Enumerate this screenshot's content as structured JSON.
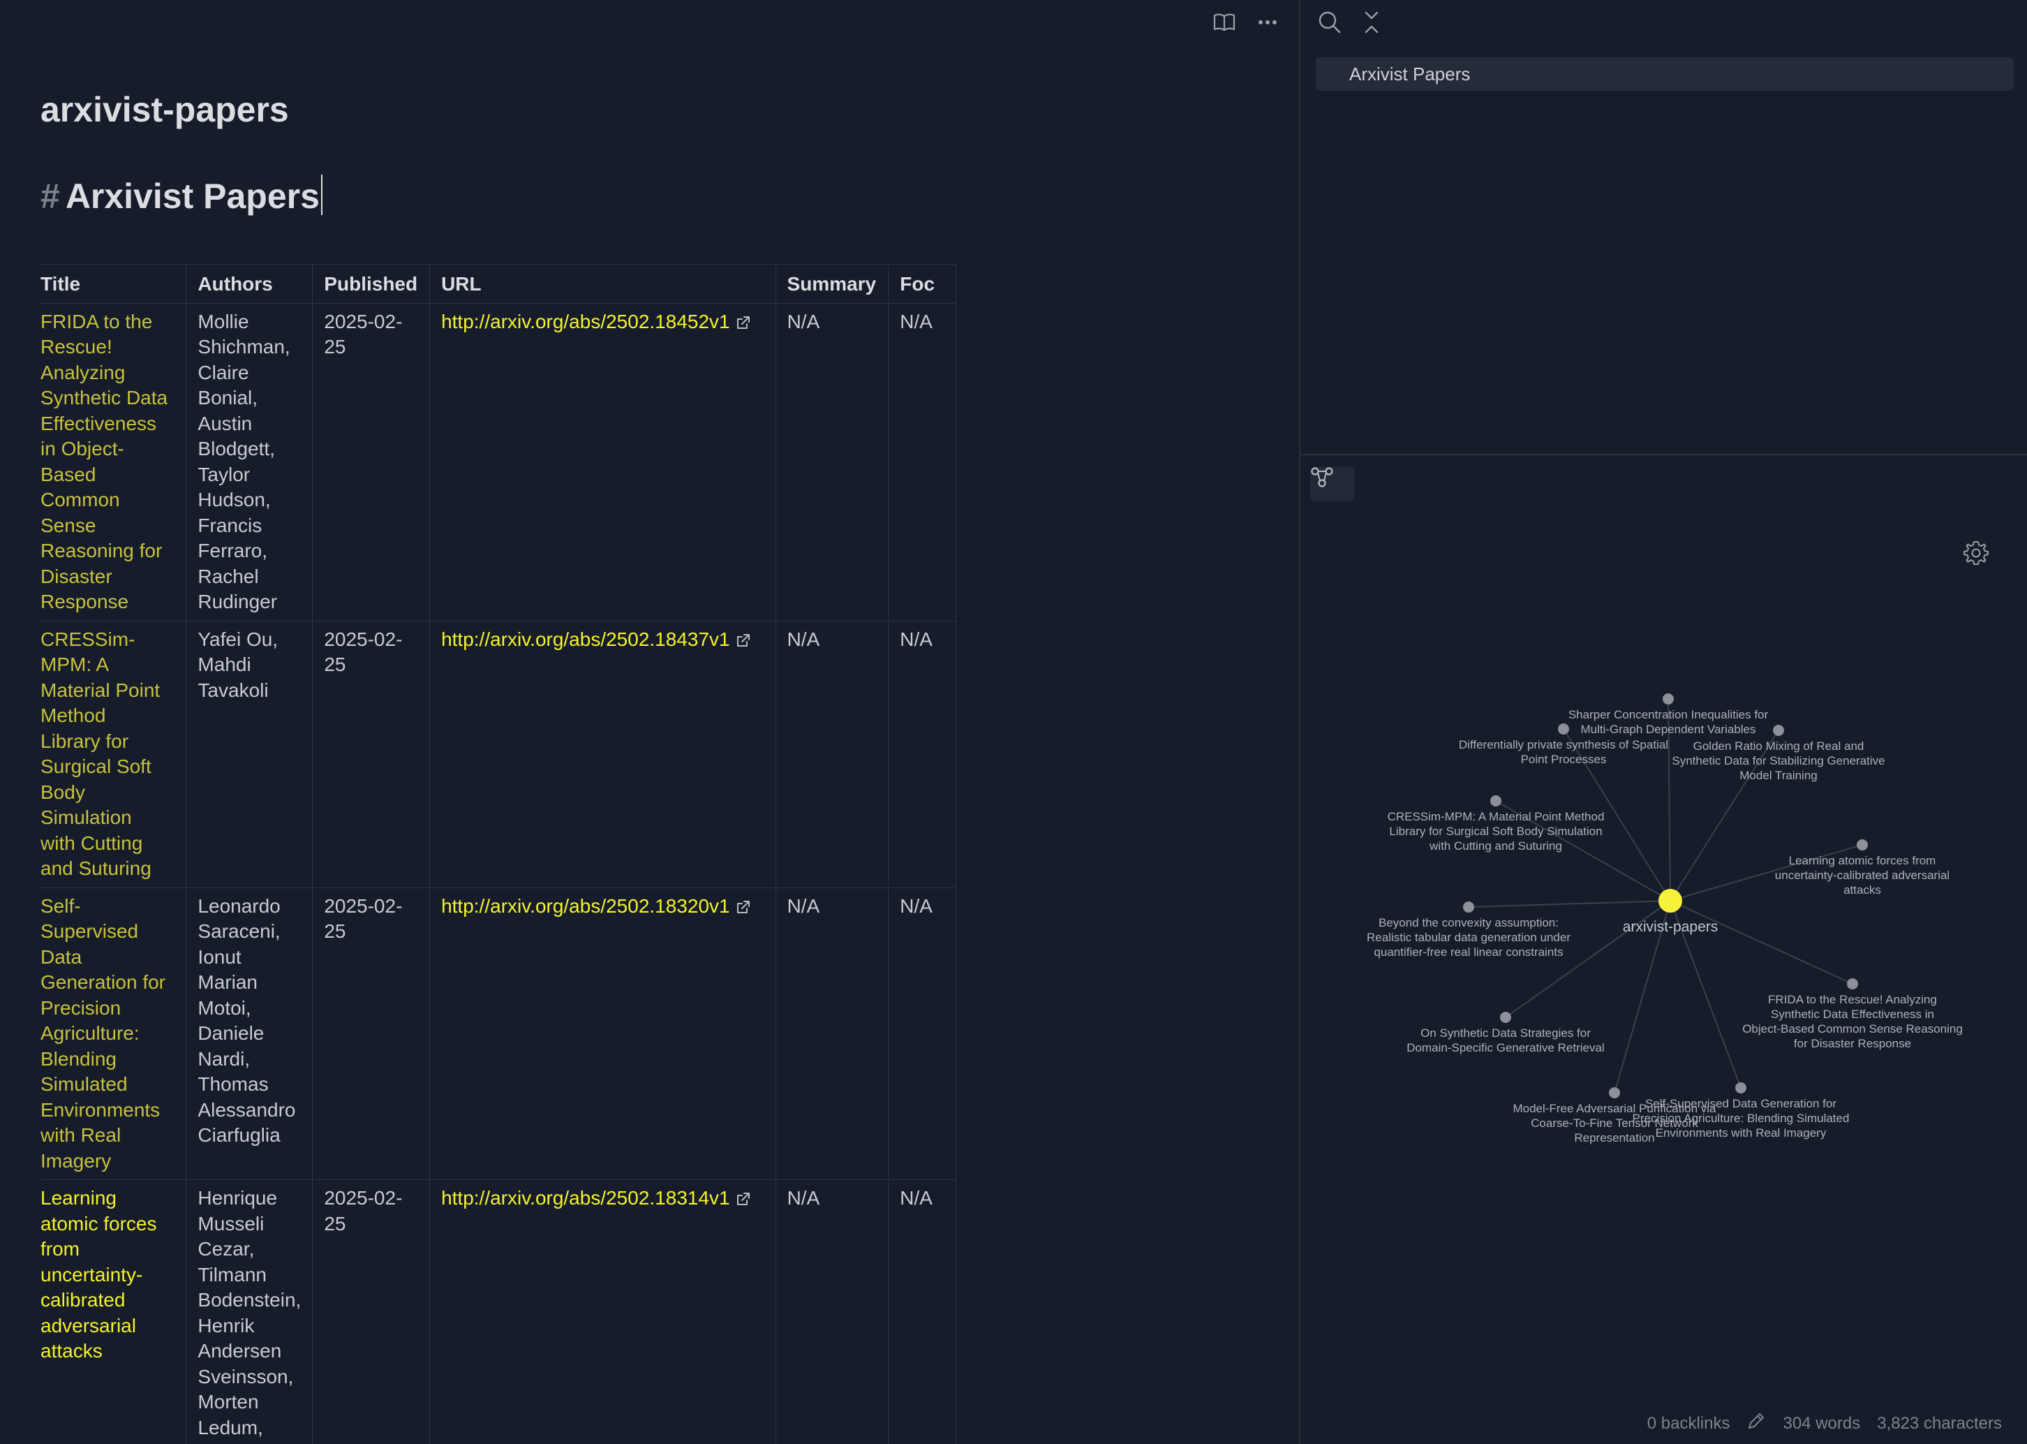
{
  "note": {
    "name": "arxivist-papers",
    "heading_hash": "#",
    "heading_text": "Arxivist Papers"
  },
  "table": {
    "headers": [
      "Title",
      "Authors",
      "Published",
      "URL",
      "Summary",
      "Foc"
    ],
    "rows": [
      {
        "title_lines": [
          "FRIDA to the",
          "Rescue!",
          "Analyzing",
          "Synthetic Data",
          "Effectiveness",
          "in Object-",
          "Based",
          "Common",
          "Sense",
          "Reasoning for",
          "Disaster",
          "Response"
        ],
        "author_lines": [
          "Mollie",
          "Shichman,",
          "Claire",
          "Bonial,",
          "Austin",
          "Blodgett,",
          "Taylor",
          "Hudson,",
          "Francis",
          "Ferraro,",
          "Rachel",
          "Rudinger"
        ],
        "published_lines": [
          "2025-02-",
          "25"
        ],
        "url": "http://arxiv.org/abs/2502.18452v1",
        "summary": "N/A",
        "foc": "N/A"
      },
      {
        "title_lines": [
          "CRESSim-",
          "MPM: A",
          "Material Point",
          "Method",
          "Library for",
          "Surgical Soft",
          "Body",
          "Simulation",
          "with Cutting",
          "and Suturing"
        ],
        "author_lines": [
          "Yafei Ou,",
          "Mahdi",
          "Tavakoli"
        ],
        "published_lines": [
          "2025-02-",
          "25"
        ],
        "url": "http://arxiv.org/abs/2502.18437v1",
        "summary": "N/A",
        "foc": "N/A"
      },
      {
        "title_lines": [
          "Self-",
          "Supervised",
          "Data",
          "Generation for",
          "Precision",
          "Agriculture:",
          "Blending",
          "Simulated",
          "Environments",
          "with Real",
          "Imagery"
        ],
        "author_lines": [
          "Leonardo",
          "Saraceni,",
          "Ionut Marian",
          "Motoi,",
          "Daniele",
          "Nardi,",
          "Thomas",
          "Alessandro",
          "Ciarfuglia"
        ],
        "published_lines": [
          "2025-02-",
          "25"
        ],
        "url": "http://arxiv.org/abs/2502.18320v1",
        "summary": "N/A",
        "foc": "N/A"
      },
      {
        "title_lines": [
          "Learning",
          "atomic forces",
          "from",
          "uncertainty-",
          "calibrated",
          "adversarial",
          "attacks"
        ],
        "author_lines": [
          "Henrique",
          "Musseli",
          "Cezar,",
          "Tilmann",
          "Bodenstein,",
          "Henrik",
          "Andersen",
          "Sveinsson,",
          "Morten",
          "Ledum,"
        ],
        "published_lines": [
          "2025-02-",
          "25"
        ],
        "url": "http://arxiv.org/abs/2502.18314v1",
        "summary": "N/A",
        "foc": "N/A"
      }
    ]
  },
  "outline": {
    "items": [
      "Arxivist Papers"
    ]
  },
  "graph": {
    "center_label": "arxivist-papers",
    "center_color": "#f6f23a",
    "node_color": "#8d9099",
    "nodes": [
      {
        "label_lines": [
          "Sharper Concentration Inequalities for",
          "Multi-Graph Dependent Variables"
        ]
      },
      {
        "label_lines": [
          "Differentially private synthesis of Spatial",
          "Point Processes"
        ]
      },
      {
        "label_lines": [
          "Golden Ratio Mixing of Real and",
          "Synthetic Data for Stabilizing Generative",
          "Model Training"
        ]
      },
      {
        "label_lines": [
          "CRESSim-MPM: A Material Point Method",
          "Library for Surgical Soft Body Simulation",
          "with Cutting and Suturing"
        ]
      },
      {
        "label_lines": [
          "Learning atomic forces from",
          "uncertainty-calibrated adversarial",
          "attacks"
        ]
      },
      {
        "label_lines": [
          "Beyond the convexity assumption:",
          "Realistic tabular data generation under",
          "quantifier-free real linear constraints"
        ]
      },
      {
        "label_lines": [
          "FRIDA to the Rescue! Analyzing",
          "Synthetic Data Effectiveness in",
          "Object-Based Common Sense Reasoning",
          "for Disaster Response"
        ]
      },
      {
        "label_lines": [
          "On Synthetic Data Strategies for",
          "Domain-Specific Generative Retrieval"
        ]
      },
      {
        "label_lines": [
          "Model-Free Adversarial Purification via",
          "Coarse-To-Fine Tensor Network",
          "Representation"
        ]
      },
      {
        "label_lines": [
          "Self-Supervised Data Generation for",
          "Precision Agriculture: Blending Simulated",
          "Environments with Real Imagery"
        ]
      }
    ]
  },
  "status": {
    "backlinks": "0 backlinks",
    "words": "304 words",
    "characters": "3,823 characters"
  },
  "icons": {
    "reading_view": "book-open-icon",
    "more": "more-horizontal-icon",
    "search": "search-icon",
    "collapse": "collapse-all-icon",
    "graph": "graph-icon",
    "settings": "gear-icon",
    "edit": "pencil-icon",
    "external_link": "external-link-icon"
  }
}
